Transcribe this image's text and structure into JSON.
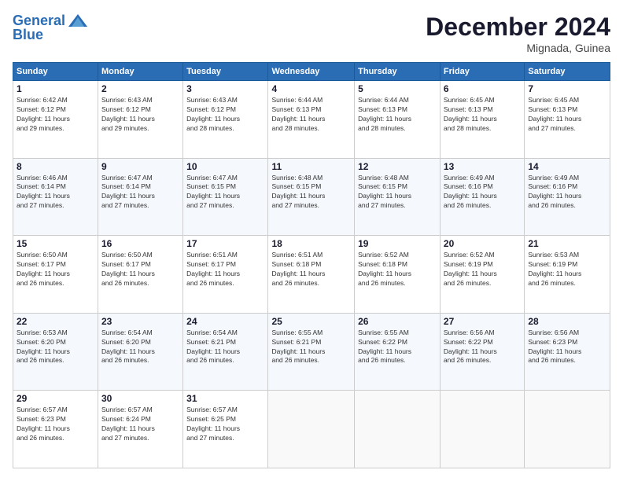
{
  "header": {
    "logo_line1": "General",
    "logo_line2": "Blue",
    "month_title": "December 2024",
    "location": "Mignada, Guinea"
  },
  "weekdays": [
    "Sunday",
    "Monday",
    "Tuesday",
    "Wednesday",
    "Thursday",
    "Friday",
    "Saturday"
  ],
  "weeks": [
    [
      {
        "day": "1",
        "info": "Sunrise: 6:42 AM\nSunset: 6:12 PM\nDaylight: 11 hours\nand 29 minutes."
      },
      {
        "day": "2",
        "info": "Sunrise: 6:43 AM\nSunset: 6:12 PM\nDaylight: 11 hours\nand 29 minutes."
      },
      {
        "day": "3",
        "info": "Sunrise: 6:43 AM\nSunset: 6:12 PM\nDaylight: 11 hours\nand 28 minutes."
      },
      {
        "day": "4",
        "info": "Sunrise: 6:44 AM\nSunset: 6:13 PM\nDaylight: 11 hours\nand 28 minutes."
      },
      {
        "day": "5",
        "info": "Sunrise: 6:44 AM\nSunset: 6:13 PM\nDaylight: 11 hours\nand 28 minutes."
      },
      {
        "day": "6",
        "info": "Sunrise: 6:45 AM\nSunset: 6:13 PM\nDaylight: 11 hours\nand 28 minutes."
      },
      {
        "day": "7",
        "info": "Sunrise: 6:45 AM\nSunset: 6:13 PM\nDaylight: 11 hours\nand 27 minutes."
      }
    ],
    [
      {
        "day": "8",
        "info": "Sunrise: 6:46 AM\nSunset: 6:14 PM\nDaylight: 11 hours\nand 27 minutes."
      },
      {
        "day": "9",
        "info": "Sunrise: 6:47 AM\nSunset: 6:14 PM\nDaylight: 11 hours\nand 27 minutes."
      },
      {
        "day": "10",
        "info": "Sunrise: 6:47 AM\nSunset: 6:15 PM\nDaylight: 11 hours\nand 27 minutes."
      },
      {
        "day": "11",
        "info": "Sunrise: 6:48 AM\nSunset: 6:15 PM\nDaylight: 11 hours\nand 27 minutes."
      },
      {
        "day": "12",
        "info": "Sunrise: 6:48 AM\nSunset: 6:15 PM\nDaylight: 11 hours\nand 27 minutes."
      },
      {
        "day": "13",
        "info": "Sunrise: 6:49 AM\nSunset: 6:16 PM\nDaylight: 11 hours\nand 26 minutes."
      },
      {
        "day": "14",
        "info": "Sunrise: 6:49 AM\nSunset: 6:16 PM\nDaylight: 11 hours\nand 26 minutes."
      }
    ],
    [
      {
        "day": "15",
        "info": "Sunrise: 6:50 AM\nSunset: 6:17 PM\nDaylight: 11 hours\nand 26 minutes."
      },
      {
        "day": "16",
        "info": "Sunrise: 6:50 AM\nSunset: 6:17 PM\nDaylight: 11 hours\nand 26 minutes."
      },
      {
        "day": "17",
        "info": "Sunrise: 6:51 AM\nSunset: 6:17 PM\nDaylight: 11 hours\nand 26 minutes."
      },
      {
        "day": "18",
        "info": "Sunrise: 6:51 AM\nSunset: 6:18 PM\nDaylight: 11 hours\nand 26 minutes."
      },
      {
        "day": "19",
        "info": "Sunrise: 6:52 AM\nSunset: 6:18 PM\nDaylight: 11 hours\nand 26 minutes."
      },
      {
        "day": "20",
        "info": "Sunrise: 6:52 AM\nSunset: 6:19 PM\nDaylight: 11 hours\nand 26 minutes."
      },
      {
        "day": "21",
        "info": "Sunrise: 6:53 AM\nSunset: 6:19 PM\nDaylight: 11 hours\nand 26 minutes."
      }
    ],
    [
      {
        "day": "22",
        "info": "Sunrise: 6:53 AM\nSunset: 6:20 PM\nDaylight: 11 hours\nand 26 minutes."
      },
      {
        "day": "23",
        "info": "Sunrise: 6:54 AM\nSunset: 6:20 PM\nDaylight: 11 hours\nand 26 minutes."
      },
      {
        "day": "24",
        "info": "Sunrise: 6:54 AM\nSunset: 6:21 PM\nDaylight: 11 hours\nand 26 minutes."
      },
      {
        "day": "25",
        "info": "Sunrise: 6:55 AM\nSunset: 6:21 PM\nDaylight: 11 hours\nand 26 minutes."
      },
      {
        "day": "26",
        "info": "Sunrise: 6:55 AM\nSunset: 6:22 PM\nDaylight: 11 hours\nand 26 minutes."
      },
      {
        "day": "27",
        "info": "Sunrise: 6:56 AM\nSunset: 6:22 PM\nDaylight: 11 hours\nand 26 minutes."
      },
      {
        "day": "28",
        "info": "Sunrise: 6:56 AM\nSunset: 6:23 PM\nDaylight: 11 hours\nand 26 minutes."
      }
    ],
    [
      {
        "day": "29",
        "info": "Sunrise: 6:57 AM\nSunset: 6:23 PM\nDaylight: 11 hours\nand 26 minutes."
      },
      {
        "day": "30",
        "info": "Sunrise: 6:57 AM\nSunset: 6:24 PM\nDaylight: 11 hours\nand 27 minutes."
      },
      {
        "day": "31",
        "info": "Sunrise: 6:57 AM\nSunset: 6:25 PM\nDaylight: 11 hours\nand 27 minutes."
      },
      {
        "day": "",
        "info": ""
      },
      {
        "day": "",
        "info": ""
      },
      {
        "day": "",
        "info": ""
      },
      {
        "day": "",
        "info": ""
      }
    ]
  ]
}
